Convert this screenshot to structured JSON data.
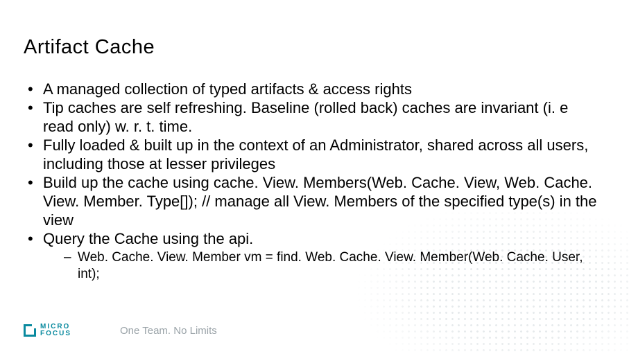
{
  "title": "Artifact Cache",
  "bullets": [
    {
      "text": " A managed collection of typed artifacts & access rights"
    },
    {
      "text": "Tip caches are self refreshing. Baseline (rolled back) caches are invariant (i. e read only) w. r. t. time."
    },
    {
      "text": "Fully loaded & built up in the context of an Administrator, shared across all users, including those at lesser privileges"
    },
    {
      "text": "Build up the cache using cache. View. Members(Web. Cache. View, Web. Cache. View. Member. Type[]); // manage all View. Members of  the specified type(s) in the view"
    },
    {
      "text": "Query the Cache using the api.",
      "sub": [
        "Web. Cache. View. Member vm = find. Web. Cache. View. Member(Web. Cache. User, int);"
      ]
    }
  ],
  "footer": {
    "logo_line1": "MICRO",
    "logo_line2": "FOCUS",
    "tagline": "One Team. No Limits"
  }
}
